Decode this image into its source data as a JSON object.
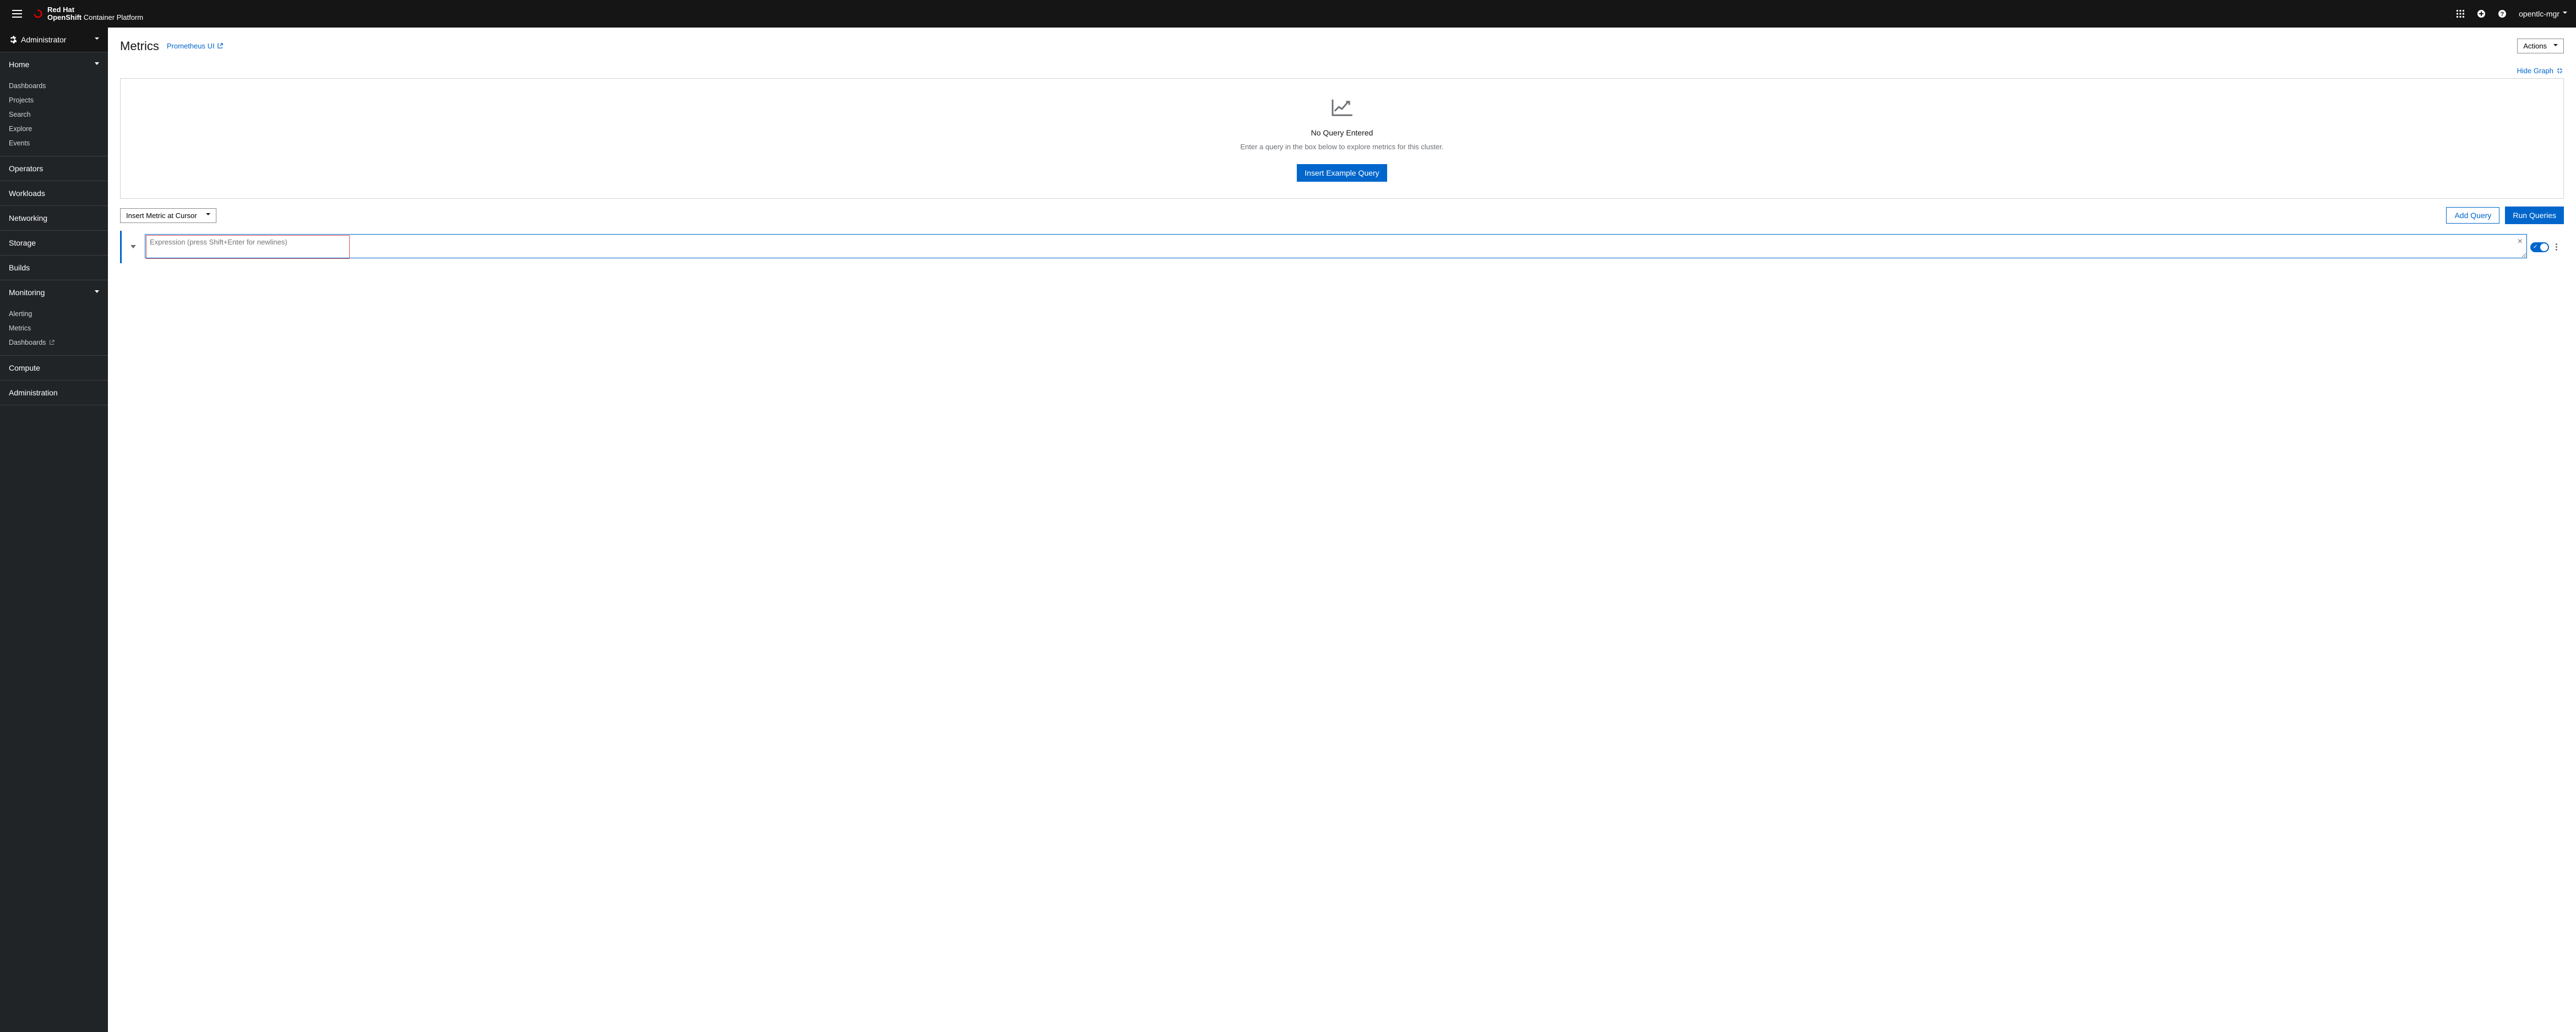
{
  "brand": {
    "vendor": "Red Hat",
    "product": "OpenShift",
    "suffix": "Container Platform"
  },
  "user": {
    "name": "opentlc-mgr"
  },
  "perspective": {
    "label": "Administrator"
  },
  "sidebar": {
    "home": {
      "label": "Home",
      "items": [
        "Dashboards",
        "Projects",
        "Search",
        "Explore",
        "Events"
      ]
    },
    "operators": {
      "label": "Operators"
    },
    "workloads": {
      "label": "Workloads"
    },
    "networking": {
      "label": "Networking"
    },
    "storage": {
      "label": "Storage"
    },
    "builds": {
      "label": "Builds"
    },
    "monitoring": {
      "label": "Monitoring",
      "items": [
        "Alerting",
        "Metrics",
        "Dashboards"
      ]
    },
    "compute": {
      "label": "Compute"
    },
    "administration": {
      "label": "Administration"
    }
  },
  "page": {
    "title": "Metrics",
    "prometheus_link": "Prometheus UI",
    "actions_label": "Actions",
    "hide_graph": "Hide Graph",
    "empty": {
      "title": "No Query Entered",
      "subtitle": "Enter a query in the box below to explore metrics for this cluster.",
      "example_btn": "Insert Example Query"
    },
    "insert_metric": "Insert Metric at Cursor",
    "add_query": "Add Query",
    "run_queries": "Run Queries",
    "expr_placeholder": "Expression (press Shift+Enter for newlines)"
  }
}
